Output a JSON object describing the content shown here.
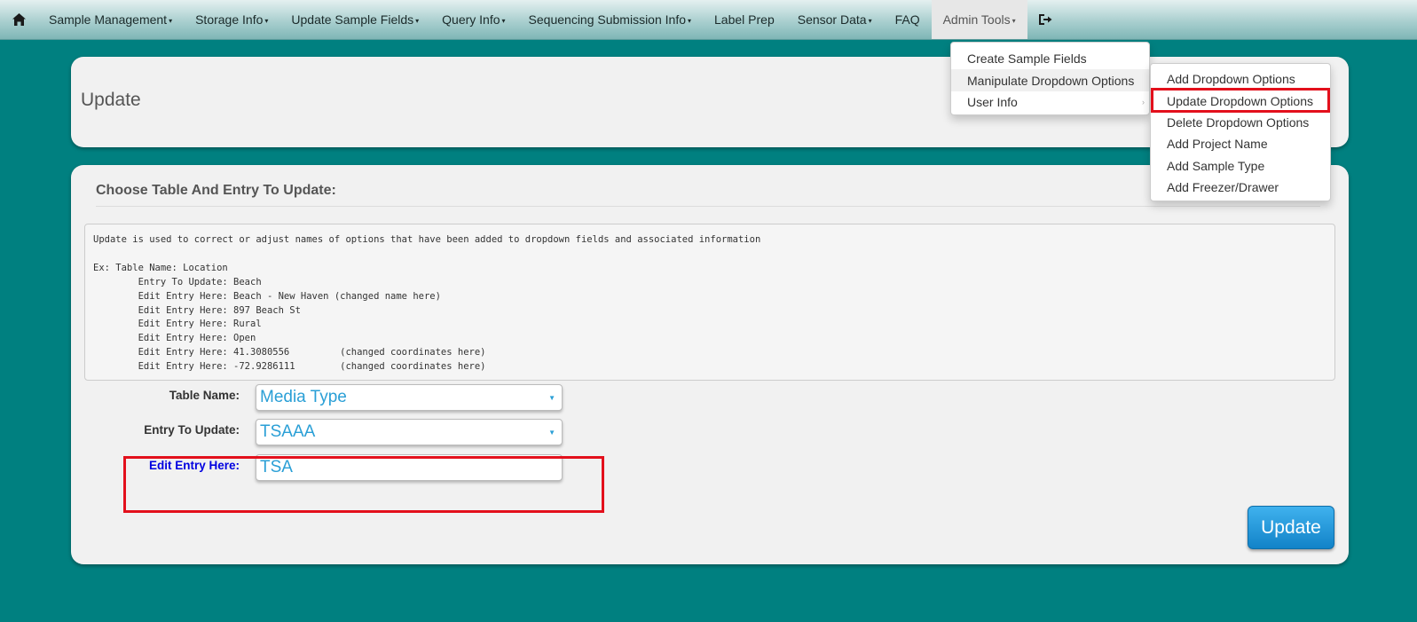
{
  "navbar": {
    "home_icon": "home-icon",
    "items": [
      {
        "label": "Sample Management",
        "caret": true
      },
      {
        "label": "Storage Info",
        "caret": true
      },
      {
        "label": "Update Sample Fields",
        "caret": true
      },
      {
        "label": "Query Info",
        "caret": true
      },
      {
        "label": "Sequencing Submission Info",
        "caret": true
      },
      {
        "label": "Label Prep",
        "caret": false
      },
      {
        "label": "Sensor Data",
        "caret": true
      },
      {
        "label": "FAQ",
        "caret": false
      },
      {
        "label": "Admin Tools",
        "caret": true
      }
    ],
    "caret_glyph": "▾",
    "logout_icon": "logout-icon"
  },
  "admin_menu": {
    "items": [
      "Create Sample Fields",
      "Manipulate Dropdown Options",
      "User Info"
    ]
  },
  "dropdown_submenu": {
    "items": [
      "Add Dropdown Options",
      "Update Dropdown Options",
      "Delete Dropdown Options",
      "Add Project Name",
      "Add Sample Type",
      "Add Freezer/Drawer"
    ]
  },
  "page": {
    "title": "Update"
  },
  "section": {
    "title": "Choose Table And Entry To Update:"
  },
  "help_text": "Update is used to correct or adjust names of options that have been added to dropdown fields and associated information\n\nEx: Table Name: Location\n        Entry To Update: Beach\n        Edit Entry Here: Beach - New Haven (changed name here)\n        Edit Entry Here: 897 Beach St\n        Edit Entry Here: Rural\n        Edit Entry Here: Open\n        Edit Entry Here: 41.3080556         (changed coordinates here)\n        Edit Entry Here: -72.9286111        (changed coordinates here)",
  "form": {
    "table_name_label": "Table Name:",
    "table_name_value": "Media Type",
    "entry_label": "Entry To Update:",
    "entry_value": "TSAAA",
    "edit_label": "Edit Entry Here:",
    "edit_value": "TSA",
    "select_arrow": "▼"
  },
  "update_button": {
    "label": "Update"
  },
  "colors": {
    "background": "#008080",
    "highlight": "#e3101c",
    "field_text": "#2a9fd6",
    "button": "#1a8fd6"
  }
}
